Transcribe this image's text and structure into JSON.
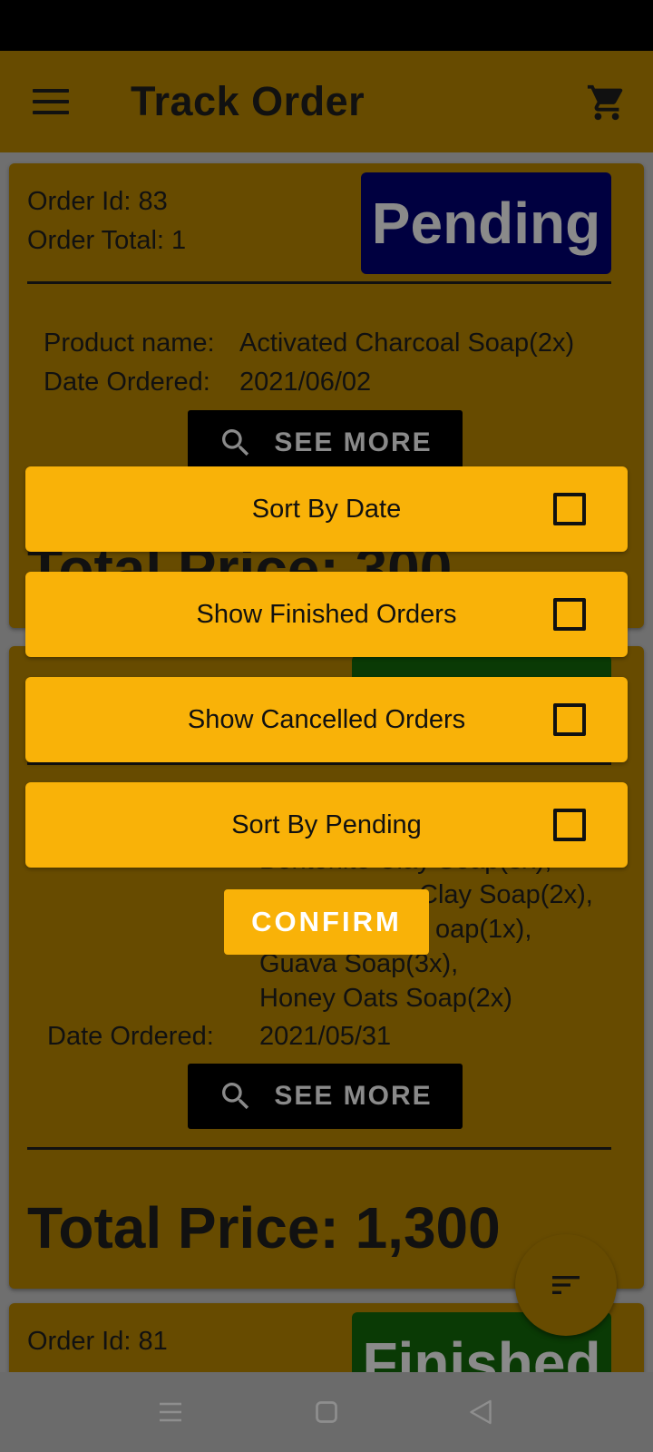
{
  "appbar": {
    "title": "Track Order",
    "menu_icon": "hamburger-menu-icon",
    "cart_icon": "shopping-cart-icon"
  },
  "orders": [
    {
      "order_id": "Order Id: 83",
      "order_total": "Order Total: 1",
      "status": "Pending",
      "status_color": "#000040",
      "product_label": "Product name:",
      "product_value": "Activated Charcoal Soap(2x)",
      "date_label": "Date Ordered:",
      "date_value": "2021/06/02",
      "see_more": "SEE MORE",
      "total_price": "Total Price: 300"
    },
    {
      "status_color": "#0a3a05",
      "product_lines": [
        "Bentonite Clay Soap(3x),",
        "Clay Soap(2x),",
        "oap(1x),",
        "Guava Soap(3x),",
        "Honey Oats Soap(2x)"
      ],
      "date_label": "Date Ordered:",
      "date_value": "2021/05/31",
      "see_more": "SEE MORE",
      "total_price": "Total Price: 1,300"
    },
    {
      "order_id": "Order Id: 81",
      "status": "Finished",
      "status_color": "#0a3a05"
    }
  ],
  "filter_dialog": {
    "options": [
      {
        "label": "Sort By Date",
        "checked": false
      },
      {
        "label": "Show Finished Orders",
        "checked": false
      },
      {
        "label": "Show Cancelled Orders",
        "checked": false
      },
      {
        "label": "Sort By Pending",
        "checked": false
      }
    ],
    "confirm_label": "CONFIRM"
  },
  "fab": {
    "icon": "sort-filter-icon"
  },
  "colors": {
    "accent": "#f9b208",
    "card": "#674b00",
    "scrim_card": "#674b00"
  }
}
